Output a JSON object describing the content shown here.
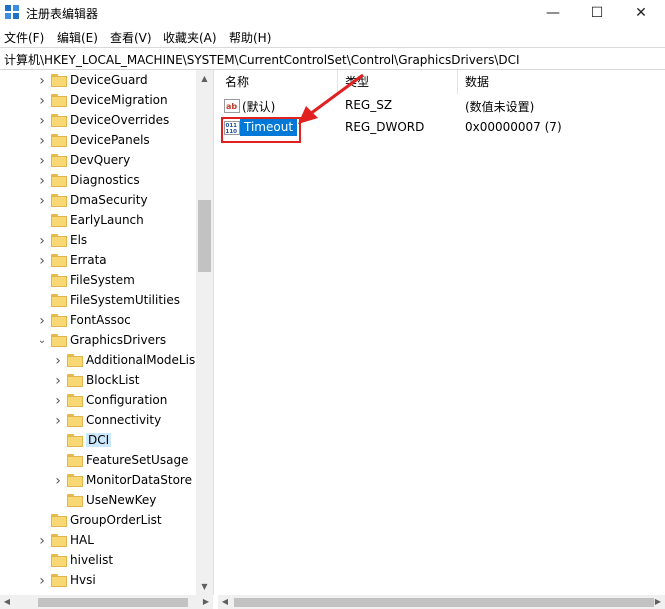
{
  "window": {
    "title": "注册表编辑器",
    "minimize": "—",
    "maximize": "☐",
    "close": "✕"
  },
  "menu": [
    {
      "label": "文件(F)"
    },
    {
      "label": "编辑(E)"
    },
    {
      "label": "查看(V)"
    },
    {
      "label": "收藏夹(A)"
    },
    {
      "label": "帮助(H)"
    }
  ],
  "address": "计算机\\HKEY_LOCAL_MACHINE\\SYSTEM\\CurrentControlSet\\Control\\GraphicsDrivers\\DCI",
  "tree": {
    "items": [
      {
        "label": "DeviceGuard",
        "level": 1,
        "chevron": "right"
      },
      {
        "label": "DeviceMigration",
        "level": 1,
        "chevron": "right"
      },
      {
        "label": "DeviceOverrides",
        "level": 1,
        "chevron": "right"
      },
      {
        "label": "DevicePanels",
        "level": 1,
        "chevron": "right"
      },
      {
        "label": "DevQuery",
        "level": 1,
        "chevron": "right"
      },
      {
        "label": "Diagnostics",
        "level": 1,
        "chevron": "right"
      },
      {
        "label": "DmaSecurity",
        "level": 1,
        "chevron": "right"
      },
      {
        "label": "EarlyLaunch",
        "level": 1,
        "chevron": "none"
      },
      {
        "label": "Els",
        "level": 1,
        "chevron": "right"
      },
      {
        "label": "Errata",
        "level": 1,
        "chevron": "right"
      },
      {
        "label": "FileSystem",
        "level": 1,
        "chevron": "none"
      },
      {
        "label": "FileSystemUtilities",
        "level": 1,
        "chevron": "none"
      },
      {
        "label": "FontAssoc",
        "level": 1,
        "chevron": "right"
      },
      {
        "label": "GraphicsDrivers",
        "level": 1,
        "chevron": "down"
      },
      {
        "label": "AdditionalModeLis",
        "level": 2,
        "chevron": "right"
      },
      {
        "label": "BlockList",
        "level": 2,
        "chevron": "right"
      },
      {
        "label": "Configuration",
        "level": 2,
        "chevron": "right"
      },
      {
        "label": "Connectivity",
        "level": 2,
        "chevron": "right"
      },
      {
        "label": "DCI",
        "level": 2,
        "chevron": "none",
        "selected": true
      },
      {
        "label": "FeatureSetUsage",
        "level": 2,
        "chevron": "none"
      },
      {
        "label": "MonitorDataStore",
        "level": 2,
        "chevron": "right"
      },
      {
        "label": "UseNewKey",
        "level": 2,
        "chevron": "none"
      },
      {
        "label": "GroupOrderList",
        "level": 1,
        "chevron": "none"
      },
      {
        "label": "HAL",
        "level": 1,
        "chevron": "right"
      },
      {
        "label": "hivelist",
        "level": 1,
        "chevron": "none"
      },
      {
        "label": "Hvsi",
        "level": 1,
        "chevron": "right"
      }
    ]
  },
  "list": {
    "columns": {
      "name": "名称",
      "type": "类型",
      "data": "数据"
    },
    "rows": [
      {
        "name": "(默认)",
        "type": "REG_SZ",
        "data": "(数值未设置)",
        "icon": "string-value-icon"
      },
      {
        "name": "Timeout",
        "type": "REG_DWORD",
        "data": "0x00000007 (7)",
        "icon": "dword-value-icon",
        "selected": true
      }
    ]
  },
  "colors": {
    "selection": "#0078d7",
    "highlight_box": "#e12020",
    "folder": "#f8d775"
  }
}
